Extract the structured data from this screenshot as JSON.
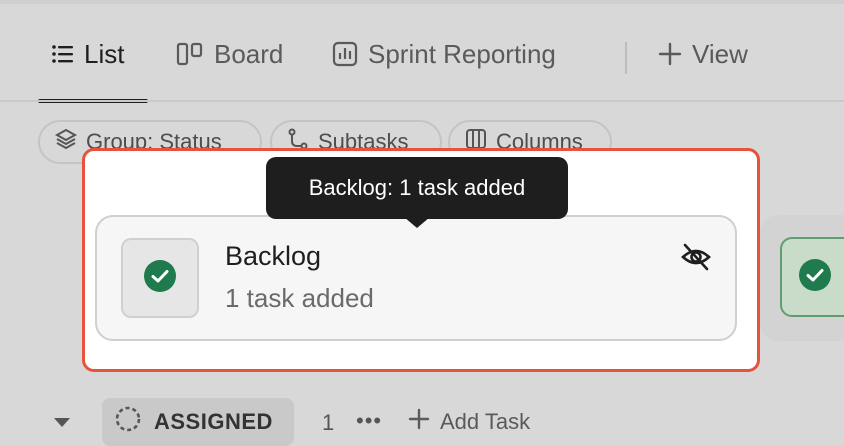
{
  "tabs": [
    {
      "label": "List",
      "icon": "list-icon",
      "active": true
    },
    {
      "label": "Board",
      "icon": "board-icon",
      "active": false
    },
    {
      "label": "Sprint Reporting",
      "icon": "chart-icon",
      "active": false
    },
    {
      "label": "View",
      "icon": "plus-icon",
      "active": false
    }
  ],
  "toolbar": {
    "group_label": "Group: Status",
    "subtasks_label": "Subtasks",
    "columns_label": "Columns"
  },
  "tooltip": {
    "text": "Backlog: 1 task added"
  },
  "card": {
    "title": "Backlog",
    "subtitle": "1 task added",
    "icon": "check-circle-icon",
    "action_icon": "eye-off-icon"
  },
  "group": {
    "status_label": "ASSIGNED",
    "count": "1",
    "more": "•••",
    "add_task_label": "Add Task"
  },
  "colors": {
    "accent_border": "#e5533a",
    "check_green": "#1f7a4d",
    "tooltip_bg": "#1e1e1e"
  }
}
